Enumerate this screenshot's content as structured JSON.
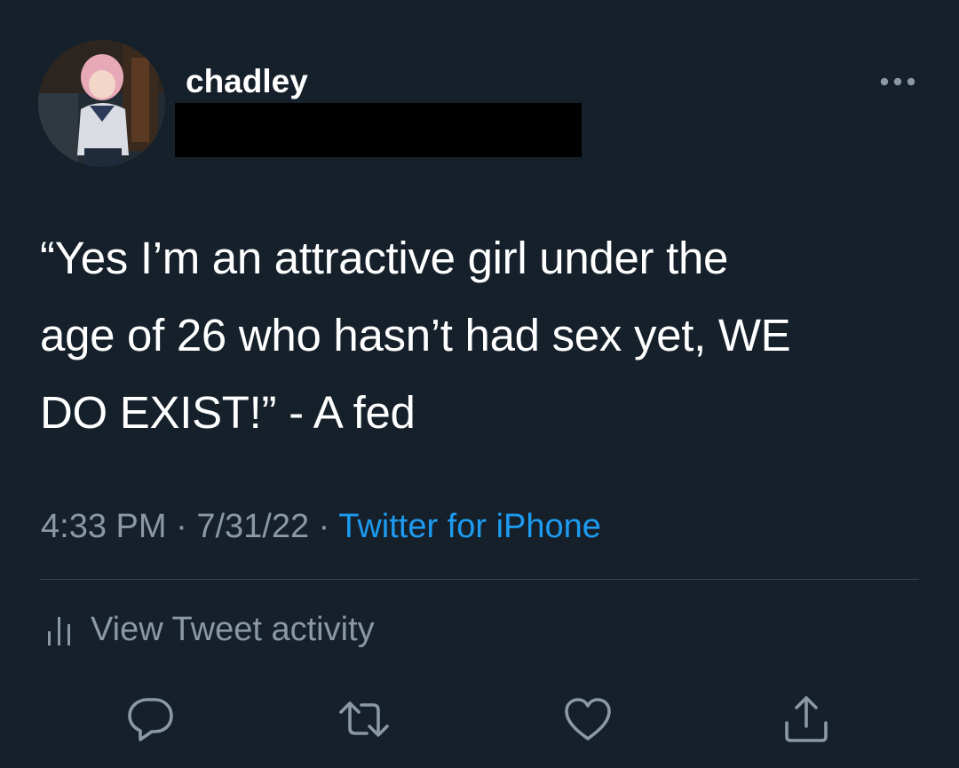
{
  "tweet": {
    "author": {
      "display_name": "chadley",
      "avatar_icon": "profile-avatar"
    },
    "text_lines": [
      "“Yes I’m an attractive girl under the",
      "age of 26 who hasn’t had sex yet, WE",
      "DO EXIST!” - A fed"
    ],
    "time": "4:33 PM",
    "separator": "·",
    "date": "7/31/22",
    "source": "Twitter for iPhone"
  },
  "activity": {
    "label": "View Tweet activity",
    "icon": "bar-chart-icon"
  },
  "actions": [
    {
      "name": "reply",
      "icon": "speech-bubble-icon"
    },
    {
      "name": "retweet",
      "icon": "retweet-arrows-icon"
    },
    {
      "name": "like",
      "icon": "heart-icon"
    },
    {
      "name": "share",
      "icon": "share-upload-icon"
    }
  ],
  "colors": {
    "background": "#15202b",
    "text": "#ffffff",
    "secondary_text": "#8b98a5",
    "link": "#1d9bf0",
    "divider": "#38444d"
  }
}
